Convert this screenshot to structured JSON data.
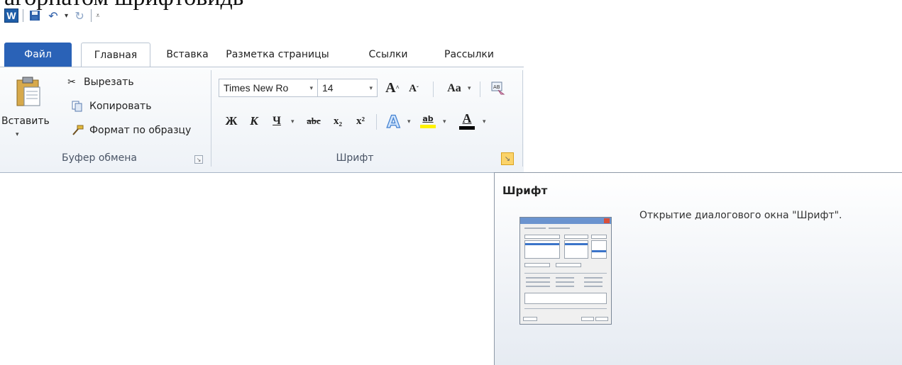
{
  "document": {
    "cut_text": "агорнатом шрифтовидь"
  },
  "quick_access": {
    "logo": "W"
  },
  "tabs": [
    {
      "label": "Файл"
    },
    {
      "label": "Главная"
    },
    {
      "label": "Вставка"
    },
    {
      "label": "Разметка страницы"
    },
    {
      "label": "Ссылки"
    },
    {
      "label": "Рассылки"
    }
  ],
  "clipboard": {
    "paste_label": "Вставить",
    "cut_label": "Вырезать",
    "copy_label": "Копировать",
    "format_painter_label": "Формат по образцу",
    "group_label": "Буфер обмена"
  },
  "font": {
    "font_name": "Times New Ro",
    "font_size": "14",
    "group_label": "Шрифт",
    "grow_label": "A",
    "shrink_label": "A",
    "case_label": "Aa",
    "bold_label": "Ж",
    "italic_label": "К",
    "underline_label": "Ч",
    "strike_label": "abc",
    "subscript_label": "x₂",
    "superscript_label": "x²",
    "highlight_label": "ab",
    "fontcolor_label": "A"
  },
  "tooltip": {
    "title": "Шрифт",
    "description": "Открытие диалогового окна \"Шрифт\"."
  },
  "colors": {
    "file_tab": "#2a62b7",
    "highlight_yellow": "#fff200",
    "font_color_bar": "#000000",
    "launcher_hot": "#fbd36a"
  }
}
